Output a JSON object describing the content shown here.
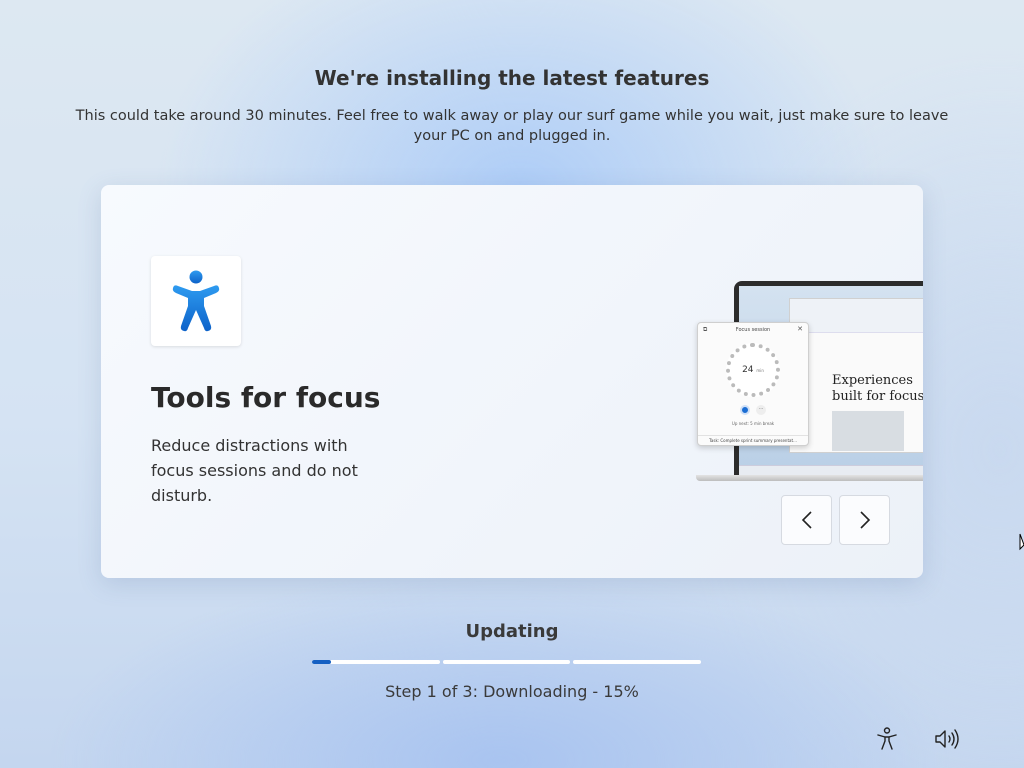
{
  "header": {
    "title": "We're installing the latest features",
    "subtitle": "This could take around 30 minutes. Feel free to walk away or play our surf game while you wait, just make sure to leave your PC on and plugged in."
  },
  "feature_card": {
    "icon": "accessibility-person-icon",
    "title": "Tools for focus",
    "description": "Reduce distractions with focus sessions and do not disturb.",
    "illustration": {
      "focus_popup_title": "Focus session",
      "focus_minutes": "24",
      "focus_minutes_unit": "min",
      "up_next": "Up next: 5 min break",
      "task": "Task: Complete sprint summary presentat...",
      "doc_heading": "Experiences built for focus"
    },
    "prev_icon": "chevron-left-icon",
    "next_icon": "chevron-right-icon"
  },
  "status": {
    "label": "Updating",
    "step_text": "Step 1 of 3: Downloading - 15%",
    "steps_total": 3,
    "current_step": 1,
    "current_step_progress": 0.15,
    "accent_color": "#1560c3"
  },
  "footer": {
    "accessibility_icon": "accessibility-icon",
    "volume_icon": "volume-icon"
  }
}
